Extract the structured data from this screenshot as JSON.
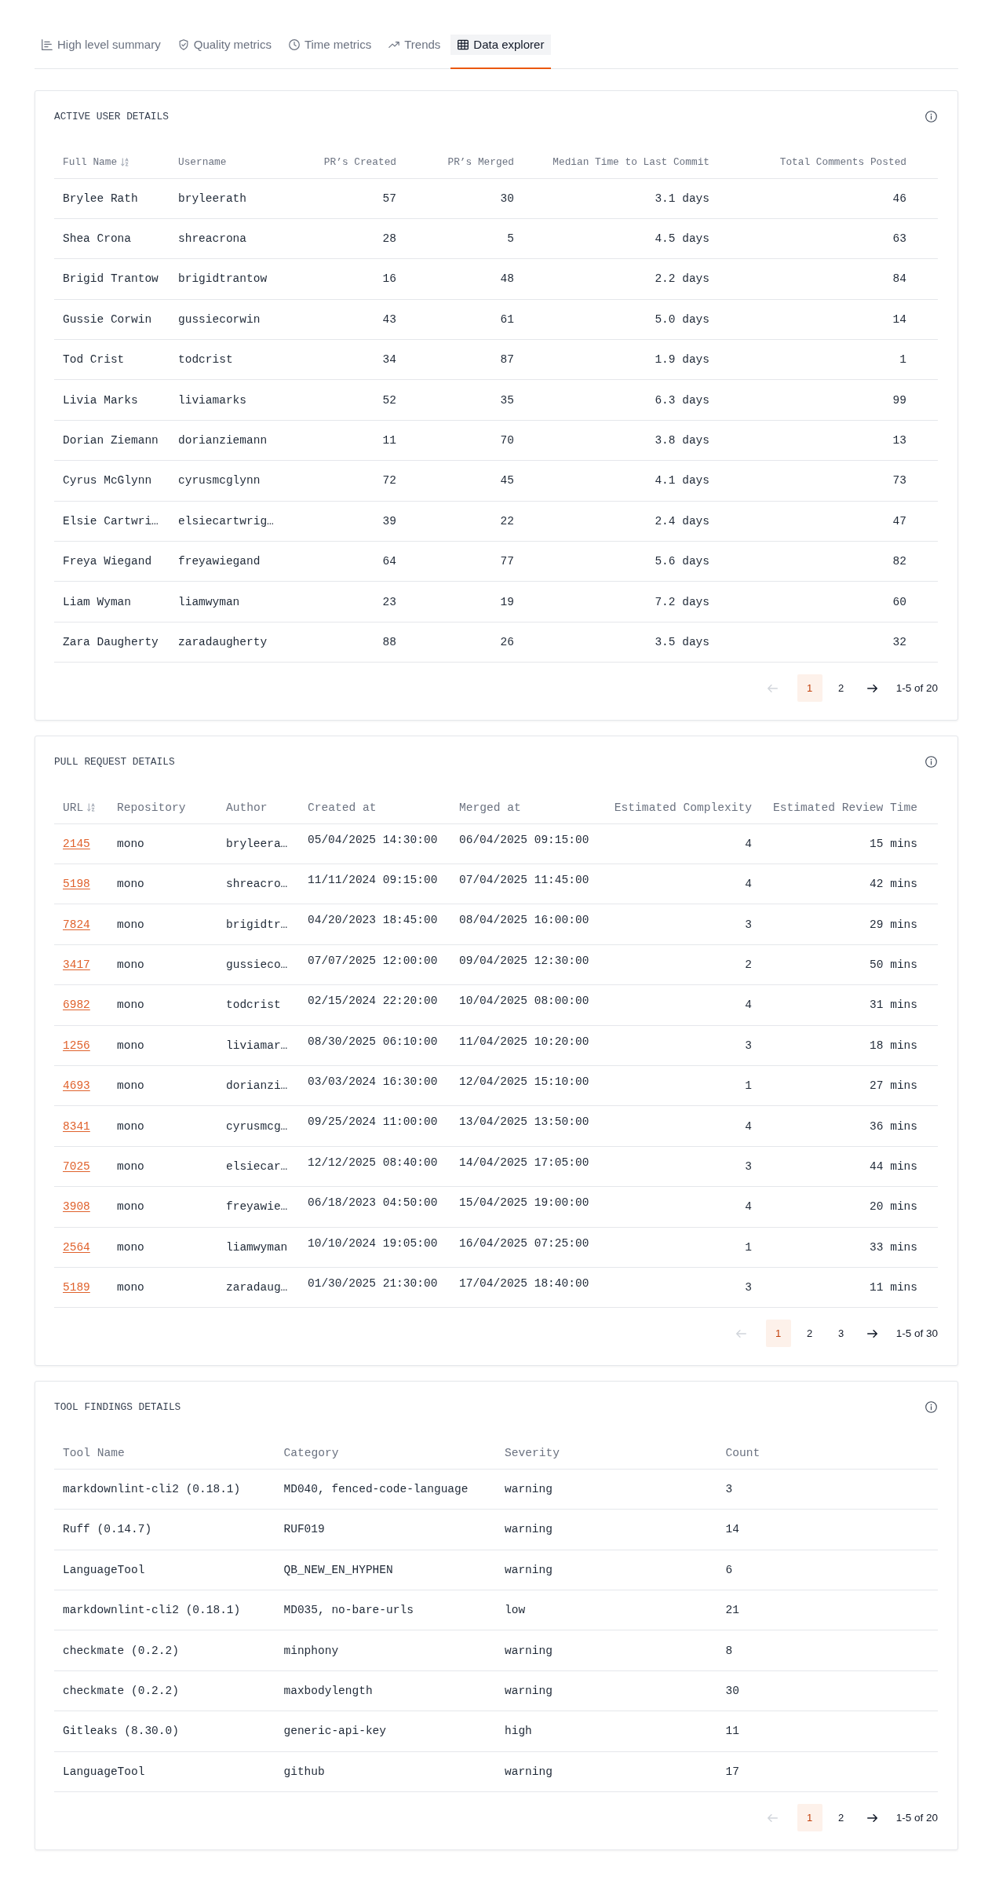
{
  "tabs": [
    {
      "label": "High level summary",
      "selected": false
    },
    {
      "label": "Quality metrics",
      "selected": false
    },
    {
      "label": "Time metrics",
      "selected": false
    },
    {
      "label": "Trends",
      "selected": false
    },
    {
      "label": "Data explorer",
      "selected": true
    }
  ],
  "cards": [
    {
      "title": "ACTIVE USER DETAILS",
      "table": {
        "columns": [
          {
            "label": "Full Name",
            "kind": "text",
            "sorted": true
          },
          {
            "label": "Username",
            "kind": "text",
            "sorted": false
          },
          {
            "label": "PR’s Created",
            "kind": "number",
            "sorted": false
          },
          {
            "label": "PR’s Merged",
            "kind": "number",
            "sorted": false
          },
          {
            "label": "Median Time to Last Commit",
            "kind": "number",
            "sorted": false
          },
          {
            "label": "Total Comments Posted",
            "kind": "number",
            "sorted": false
          }
        ],
        "rows": [
          [
            "Brylee Rath",
            "bryleerath",
            "57",
            "30",
            "3.1 days",
            "46"
          ],
          [
            "Shea Crona",
            "shreacrona",
            "28",
            "5",
            "4.5 days",
            "63"
          ],
          [
            "Brigid Trantow",
            "brigidtrantow",
            "16",
            "48",
            "2.2 days",
            "84"
          ],
          [
            "Gussie Corwin",
            "gussiecorwin",
            "43",
            "61",
            "5.0 days",
            "14"
          ],
          [
            "Tod Crist",
            "todcrist",
            "34",
            "87",
            "1.9 days",
            "1"
          ],
          [
            "Livia Marks",
            "liviamarks",
            "52",
            "35",
            "6.3 days",
            "99"
          ],
          [
            "Dorian Ziemann",
            "dorianziemann",
            "11",
            "70",
            "3.8 days",
            "13"
          ],
          [
            "Cyrus McGlynn",
            "cyrusmcglynn",
            "72",
            "45",
            "4.1 days",
            "73"
          ],
          [
            "Elsie Cartwri…",
            "elsiecartwrig…",
            "39",
            "22",
            "2.4 days",
            "47"
          ],
          [
            "Freya Wiegand",
            "freyawiegand",
            "64",
            "77",
            "5.6 days",
            "82"
          ],
          [
            "Liam Wyman",
            "liamwyman",
            "23",
            "19",
            "7.2 days",
            "60"
          ],
          [
            "Zara Daugherty",
            "zaradaugherty",
            "88",
            "26",
            "3.5 days",
            "32"
          ]
        ]
      },
      "pagination": {
        "previous_disabled": true,
        "next_disabled": false,
        "pages": [
          {
            "label": "1",
            "selected": true
          },
          {
            "label": "2",
            "selected": false
          }
        ],
        "range": "1-5 of 20"
      }
    },
    {
      "title": "PULL REQUEST DETAILS",
      "table": {
        "columns": [
          {
            "label": "URL",
            "kind": "link",
            "sorted": true
          },
          {
            "label": "Repository",
            "kind": "text",
            "sorted": false
          },
          {
            "label": "Author",
            "kind": "text",
            "sorted": false
          },
          {
            "label": "Created at",
            "kind": "date",
            "sorted": false
          },
          {
            "label": "Merged at",
            "kind": "date",
            "sorted": false
          },
          {
            "label": "Estimated Complexity",
            "kind": "number",
            "sorted": false
          },
          {
            "label": "Estimated Review Time",
            "kind": "number",
            "sorted": false
          }
        ],
        "rows": [
          [
            "2145",
            "mono",
            "bryleera…",
            "05/04/2025 14:30:00",
            "06/04/2025 09:15:00",
            "4",
            "15 mins"
          ],
          [
            "5198",
            "mono",
            "shreacro…",
            "11/11/2024 09:15:00",
            "07/04/2025 11:45:00",
            "4",
            "42 mins"
          ],
          [
            "7824",
            "mono",
            "brigidtr…",
            "04/20/2023 18:45:00",
            "08/04/2025 16:00:00",
            "3",
            "29 mins"
          ],
          [
            "3417",
            "mono",
            "gussieco…",
            "07/07/2025 12:00:00",
            "09/04/2025 12:30:00",
            "2",
            "50 mins"
          ],
          [
            "6982",
            "mono",
            "todcrist",
            "02/15/2024 22:20:00",
            "10/04/2025 08:00:00",
            "4",
            "31 mins"
          ],
          [
            "1256",
            "mono",
            "liviamar…",
            "08/30/2025 06:10:00",
            "11/04/2025 10:20:00",
            "3",
            "18 mins"
          ],
          [
            "4693",
            "mono",
            "dorianzi…",
            "03/03/2024 16:30:00",
            "12/04/2025 15:10:00",
            "1",
            "27 mins"
          ],
          [
            "8341",
            "mono",
            "cyrusmcg…",
            "09/25/2024 11:00:00",
            "13/04/2025 13:50:00",
            "4",
            "36 mins"
          ],
          [
            "7025",
            "mono",
            "elsiecar…",
            "12/12/2025 08:40:00",
            "14/04/2025 17:05:00",
            "3",
            "44 mins"
          ],
          [
            "3908",
            "mono",
            "freyawie…",
            "06/18/2023 04:50:00",
            "15/04/2025 19:00:00",
            "4",
            "20 mins"
          ],
          [
            "2564",
            "mono",
            "liamwyman",
            "10/10/2024 19:05:00",
            "16/04/2025 07:25:00",
            "1",
            "33 mins"
          ],
          [
            "5189",
            "mono",
            "zaradaug…",
            "01/30/2025 21:30:00",
            "17/04/2025 18:40:00",
            "3",
            "11 mins"
          ]
        ]
      },
      "pagination": {
        "previous_disabled": true,
        "next_disabled": false,
        "pages": [
          {
            "label": "1",
            "selected": true
          },
          {
            "label": "2",
            "selected": false
          },
          {
            "label": "3",
            "selected": false
          }
        ],
        "range": "1-5 of 30"
      }
    },
    {
      "title": "TOOL FINDINGS DETAILS",
      "table": {
        "columns": [
          {
            "label": "Tool Name",
            "kind": "text",
            "sorted": false
          },
          {
            "label": "Category",
            "kind": "text",
            "sorted": false
          },
          {
            "label": "Severity",
            "kind": "text",
            "sorted": false
          },
          {
            "label": "Count",
            "kind": "text",
            "sorted": false
          }
        ],
        "rows": [
          [
            "markdownlint-cli2 (0.18.1)",
            "MD040, fenced-code-language",
            "warning",
            "3"
          ],
          [
            "Ruff (0.14.7)",
            "RUF019",
            "warning",
            "14"
          ],
          [
            "LanguageTool",
            "QB_NEW_EN_HYPHEN",
            "warning",
            "6"
          ],
          [
            "markdownlint-cli2 (0.18.1)",
            "MD035, no-bare-urls",
            "low",
            "21"
          ],
          [
            "checkmate (0.2.2)",
            "minphony",
            "warning",
            "8"
          ],
          [
            "checkmate (0.2.2)",
            "maxbodylength",
            "warning",
            "30"
          ],
          [
            "Gitleaks (8.30.0)",
            "generic-api-key",
            "high",
            "11"
          ],
          [
            "LanguageTool",
            "github",
            "warning",
            "17"
          ]
        ]
      },
      "pagination": {
        "previous_disabled": true,
        "next_disabled": false,
        "pages": [
          {
            "label": "1",
            "selected": true
          },
          {
            "label": "2",
            "selected": false
          }
        ],
        "range": "1-5 of 20"
      }
    }
  ]
}
